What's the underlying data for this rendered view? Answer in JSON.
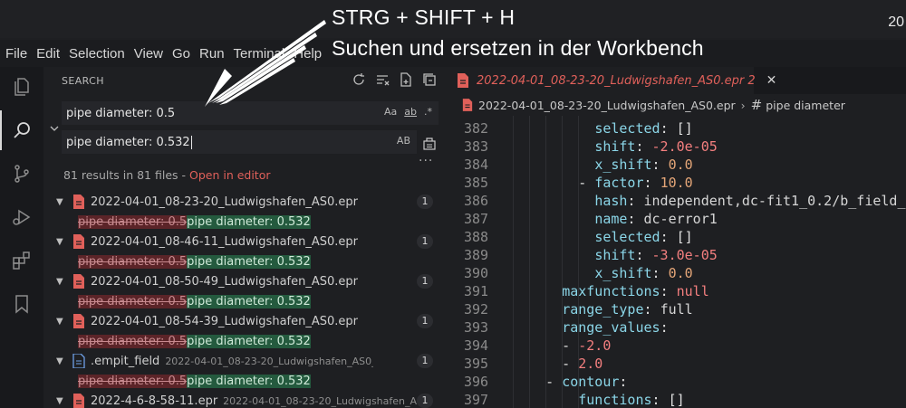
{
  "window": {
    "top_right_text": "20"
  },
  "overlay": {
    "line1": "STRG + SHIFT + H",
    "line2": "Suchen und ersetzen in der Workbench"
  },
  "menu": [
    "File",
    "Edit",
    "Selection",
    "View",
    "Go",
    "Run",
    "Terminal",
    "Help"
  ],
  "activity_icons": [
    "explorer-icon",
    "search-icon",
    "source-control-icon",
    "run-debug-icon",
    "extensions-icon",
    "bookmark-icon"
  ],
  "search": {
    "title": "SEARCH",
    "find_value": "pipe diameter: 0.5",
    "replace_value": "pipe diameter: 0.532",
    "find_opts": {
      "case": "Aa",
      "word": "ab",
      "regex": ".*"
    },
    "replace_opt": "AB",
    "summary": "81 results in 81 files - ",
    "open_in_editor": "Open in editor",
    "more": "···"
  },
  "results": [
    {
      "name": "2022-04-01_08-23-20_Ludwigshafen_AS0.epr",
      "path": "",
      "count": "1",
      "icon": "epr-file-icon",
      "old": "pipe diameter: 0.5",
      "new": "pipe diameter: 0.532"
    },
    {
      "name": "2022-04-01_08-46-11_Ludwigshafen_AS0.epr",
      "path": "",
      "count": "1",
      "icon": "epr-file-icon",
      "old": "pipe diameter: 0.5",
      "new": "pipe diameter: 0.532"
    },
    {
      "name": "2022-04-01_08-50-49_Ludwigshafen_AS0.epr",
      "path": "",
      "count": "1",
      "icon": "epr-file-icon",
      "old": "pipe diameter: 0.5",
      "new": "pipe diameter: 0.532"
    },
    {
      "name": "2022-04-01_08-54-39_Ludwigshafen_AS0.epr",
      "path": "",
      "count": "1",
      "icon": "epr-file-icon",
      "old": "pipe diameter: 0.5",
      "new": "pipe diameter: 0.532"
    },
    {
      "name": ".empit_field",
      "path": "2022-04-01_08-23-20_Ludwigshafen_AS0_data",
      "count": "1",
      "icon": "plain-file-icon",
      "old": "pipe diameter: 0.5",
      "new": "pipe diameter: 0.532"
    },
    {
      "name": "2022-4-6-8-58-11.epr",
      "path": "2022-04-01_08-23-20_Ludwigshafen_AS...",
      "count": "1",
      "icon": "epr-file-icon",
      "old": "",
      "new": ""
    }
  ],
  "editor": {
    "tab_label": "2022-04-01_08-23-20_Ludwigshafen_AS0.epr 2",
    "breadcrumb_file": "2022-04-01_08-23-20_Ludwigshafen_AS0.epr",
    "breadcrumb_symbol": "pipe diameter",
    "lines": [
      {
        "n": "382",
        "indent": "          ",
        "key": "selected",
        "sep": ": ",
        "val": "[]",
        "cls": "d"
      },
      {
        "n": "383",
        "indent": "          ",
        "key": "shift",
        "sep": ": ",
        "val": "-2.0e-05",
        "cls": "r"
      },
      {
        "n": "384",
        "indent": "          ",
        "key": "x_shift",
        "sep": ": ",
        "val": "0.0",
        "cls": "n"
      },
      {
        "n": "385",
        "indent": "        - ",
        "key": "factor",
        "sep": ": ",
        "val": "10.0",
        "cls": "n"
      },
      {
        "n": "386",
        "indent": "          ",
        "key": "hash",
        "sep": ": ",
        "val": "independent,dc-fit1_0.2/b_field_",
        "cls": "s"
      },
      {
        "n": "387",
        "indent": "          ",
        "key": "name",
        "sep": ": ",
        "val": "dc-error1",
        "cls": "s"
      },
      {
        "n": "388",
        "indent": "          ",
        "key": "selected",
        "sep": ": ",
        "val": "[]",
        "cls": "d"
      },
      {
        "n": "389",
        "indent": "          ",
        "key": "shift",
        "sep": ": ",
        "val": "-3.0e-05",
        "cls": "r"
      },
      {
        "n": "390",
        "indent": "          ",
        "key": "x_shift",
        "sep": ": ",
        "val": "0.0",
        "cls": "n"
      },
      {
        "n": "391",
        "indent": "      ",
        "key": "maxfunctions",
        "sep": ": ",
        "val": "null",
        "cls": "r"
      },
      {
        "n": "392",
        "indent": "      ",
        "key": "range_type",
        "sep": ": ",
        "val": "full",
        "cls": "s"
      },
      {
        "n": "393",
        "indent": "      ",
        "key": "range_values",
        "sep": ":",
        "val": "",
        "cls": "s"
      },
      {
        "n": "394",
        "indent": "      - ",
        "key": "",
        "sep": "",
        "val": "-2.0",
        "cls": "r"
      },
      {
        "n": "395",
        "indent": "      - ",
        "key": "",
        "sep": "",
        "val": "2.0",
        "cls": "r"
      },
      {
        "n": "396",
        "indent": "    - ",
        "key": "contour",
        "sep": ":",
        "val": "",
        "cls": "s"
      },
      {
        "n": "397",
        "indent": "        ",
        "key": "functions",
        "sep": ": ",
        "val": "[]",
        "cls": "d"
      }
    ]
  }
}
